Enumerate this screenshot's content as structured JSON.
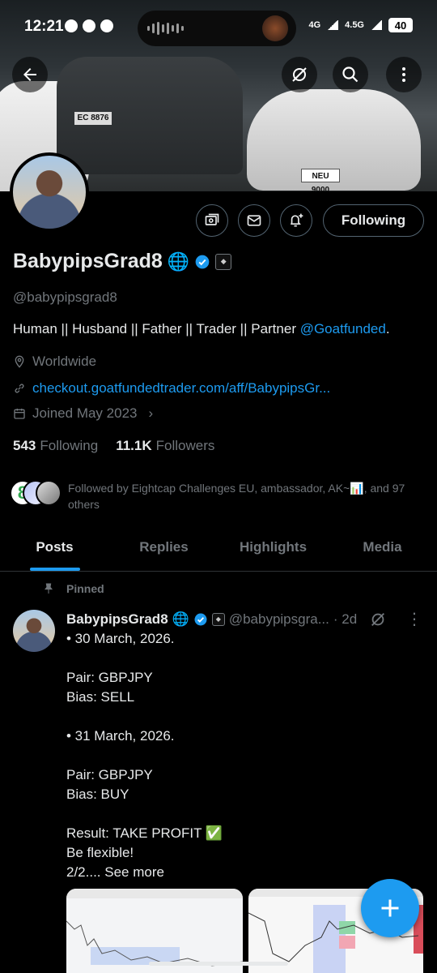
{
  "status_bar": {
    "time": "12:21",
    "net_top": "4G",
    "net_top_2": "4.5G",
    "battery": "40"
  },
  "banner": {
    "plate_left": "EC 8876",
    "plate_right": "NEU 9000"
  },
  "profile": {
    "display_name": "BabypipsGrad8",
    "name_emoji": "🌐",
    "handle": "@babypipsgrad8",
    "bio_text": "Human || Husband || Father || Trader || Partner ",
    "bio_mention": "@Goatfunded",
    "bio_end": ".",
    "location": "Worldwide",
    "website": "checkout.goatfundedtrader.com/aff/BabypipsGr...",
    "joined": "Joined May 2023",
    "following_count": "543",
    "following_label": "Following",
    "followers_count": "11.1K",
    "followers_label": "Followers",
    "followed_by": "Followed by Eightcap Challenges EU, ambassador, AK~📊, and 97 others",
    "follow_button": "Following"
  },
  "tabs": [
    "Posts",
    "Replies",
    "Highlights",
    "Media"
  ],
  "pinned_post": {
    "pinned_label": "Pinned",
    "author": "BabypipsGrad8",
    "author_emoji": "🌐",
    "handle": "@babypipsgra...",
    "time": "· 2d",
    "text": "• 30 March, 2026.\n\nPair: GBPJPY\nBias: SELL\n\n• 31 March, 2026.\n\nPair: GBPJPY\nBias: BUY\n\nResult: TAKE PROFIT ✅\nBe flexible!\n2/2.... ",
    "see_more": "See more",
    "more_menu": "⋮"
  },
  "colors": {
    "accent": "#1d9bf0",
    "background": "#000000",
    "muted_text": "#71767b",
    "border": "#2f3336"
  },
  "icons": {
    "back": "arrow-left-icon",
    "grok": "grok-icon",
    "search": "search-icon",
    "more": "more-vertical-icon",
    "subscriptions": "money-icon",
    "message": "envelope-icon",
    "notify": "bell-plus-icon",
    "location": "location-pin-icon",
    "link": "link-icon",
    "calendar": "calendar-icon",
    "pin": "pin-icon",
    "compose": "plus-icon"
  }
}
